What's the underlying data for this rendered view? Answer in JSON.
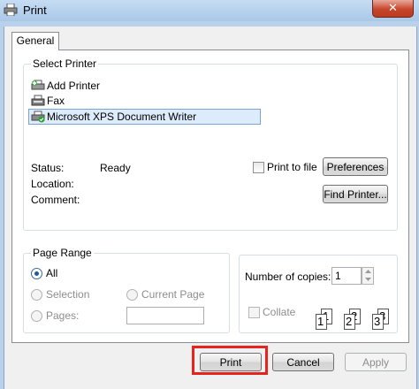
{
  "window": {
    "title": "Print",
    "close_symbol": "✕"
  },
  "tabs": [
    {
      "label": "General"
    }
  ],
  "select_printer": {
    "legend": "Select Printer",
    "printers": [
      {
        "label": "Add Printer",
        "icon": "add-printer-icon"
      },
      {
        "label": "Fax",
        "icon": "fax-printer-icon"
      },
      {
        "label": "Microsoft XPS Document Writer",
        "icon": "xps-printer-icon",
        "selected": true
      }
    ],
    "status_label": "Status:",
    "status_value": "Ready",
    "location_label": "Location:",
    "comment_label": "Comment:",
    "print_to_file_label": "Print to file",
    "print_to_file_checked": false,
    "preferences_label": "Preferences",
    "find_printer_label": "Find Printer..."
  },
  "page_range": {
    "legend": "Page Range",
    "all_label": "All",
    "selection_label": "Selection",
    "current_page_label": "Current Page",
    "pages_label": "Pages:",
    "pages_value": "",
    "selected_option": "All"
  },
  "copies": {
    "label": "Number of copies:",
    "value": "1",
    "collate_label": "Collate",
    "collate_checked": false,
    "collate_digits": [
      "1",
      "1",
      "2",
      "2",
      "3",
      "3"
    ]
  },
  "actions": {
    "print_label": "Print",
    "cancel_label": "Cancel",
    "apply_label": "Apply"
  },
  "colors": {
    "highlight": "#e8231d",
    "title_bg": "#b9d1ea",
    "selection_bg": "#dcecfc"
  }
}
